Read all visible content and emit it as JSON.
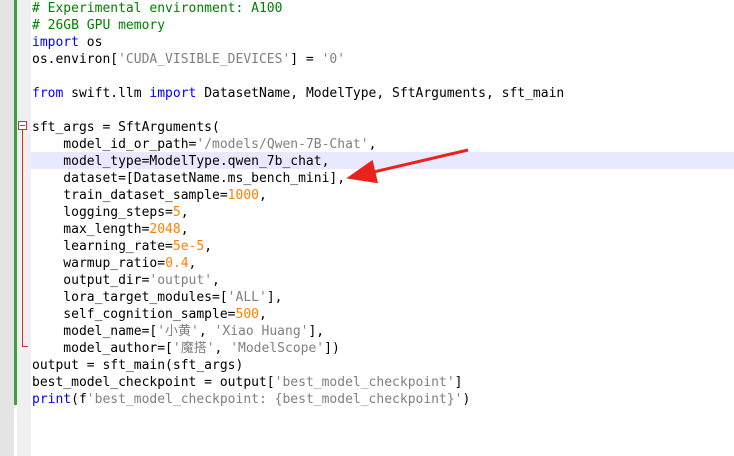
{
  "editor": {
    "lines": [
      [
        {
          "c": "cm",
          "t": "# Experimental environment: A100"
        }
      ],
      [
        {
          "c": "cm",
          "t": "# 26GB GPU memory"
        }
      ],
      [
        {
          "c": "kw",
          "t": "import"
        },
        {
          "c": "",
          "t": " os"
        }
      ],
      [
        {
          "c": "",
          "t": "os.environ["
        },
        {
          "c": "st",
          "t": "'CUDA_VISIBLE_DEVICES'"
        },
        {
          "c": "",
          "t": "] = "
        },
        {
          "c": "st",
          "t": "'0'"
        }
      ],
      [],
      [
        {
          "c": "kw",
          "t": "from"
        },
        {
          "c": "",
          "t": " swift.llm "
        },
        {
          "c": "kw",
          "t": "import"
        },
        {
          "c": "",
          "t": " DatasetName, ModelType, SftArguments, sft_main"
        }
      ],
      [],
      [
        {
          "c": "",
          "t": "sft_args = SftArguments("
        }
      ],
      [
        {
          "c": "",
          "t": "    model_id_or_path="
        },
        {
          "c": "st",
          "t": "'/models/Qwen-7B-Chat'"
        },
        {
          "c": "",
          "t": ","
        }
      ],
      [
        {
          "c": "",
          "t": "    model_type=ModelType.qwen_7b_chat,"
        }
      ],
      [
        {
          "c": "",
          "t": "    dataset=[DatasetName.ms_bench_mini],"
        }
      ],
      [
        {
          "c": "",
          "t": "    train_dataset_sample="
        },
        {
          "c": "nm",
          "t": "1000"
        },
        {
          "c": "",
          "t": ","
        }
      ],
      [
        {
          "c": "",
          "t": "    logging_steps="
        },
        {
          "c": "nm",
          "t": "5"
        },
        {
          "c": "",
          "t": ","
        }
      ],
      [
        {
          "c": "",
          "t": "    max_length="
        },
        {
          "c": "nm",
          "t": "2048"
        },
        {
          "c": "",
          "t": ","
        }
      ],
      [
        {
          "c": "",
          "t": "    learning_rate="
        },
        {
          "c": "nm",
          "t": "5e-5"
        },
        {
          "c": "",
          "t": ","
        }
      ],
      [
        {
          "c": "",
          "t": "    warmup_ratio="
        },
        {
          "c": "nm",
          "t": "0.4"
        },
        {
          "c": "",
          "t": ","
        }
      ],
      [
        {
          "c": "",
          "t": "    output_dir="
        },
        {
          "c": "st",
          "t": "'output'"
        },
        {
          "c": "",
          "t": ","
        }
      ],
      [
        {
          "c": "",
          "t": "    lora_target_modules=["
        },
        {
          "c": "st",
          "t": "'ALL'"
        },
        {
          "c": "",
          "t": "],"
        }
      ],
      [
        {
          "c": "",
          "t": "    self_cognition_sample="
        },
        {
          "c": "nm",
          "t": "500"
        },
        {
          "c": "",
          "t": ","
        }
      ],
      [
        {
          "c": "",
          "t": "    model_name=["
        },
        {
          "c": "st",
          "t": "'小黄'"
        },
        {
          "c": "",
          "t": ", "
        },
        {
          "c": "st",
          "t": "'Xiao Huang'"
        },
        {
          "c": "",
          "t": "],"
        }
      ],
      [
        {
          "c": "",
          "t": "    model_author=["
        },
        {
          "c": "st",
          "t": "'魔搭'"
        },
        {
          "c": "",
          "t": ", "
        },
        {
          "c": "st",
          "t": "'ModelScope'"
        },
        {
          "c": "",
          "t": "])"
        }
      ],
      [
        {
          "c": "",
          "t": "output = sft_main(sft_args)"
        }
      ],
      [
        {
          "c": "",
          "t": "best_model_checkpoint = output["
        },
        {
          "c": "st",
          "t": "'best_model_checkpoint'"
        },
        {
          "c": "",
          "t": "]"
        }
      ],
      [
        {
          "c": "kw",
          "t": "print"
        },
        {
          "c": "",
          "t": "(f"
        },
        {
          "c": "st",
          "t": "'best_model_checkpoint: {best_model_checkpoint}'"
        },
        {
          "c": "",
          "t": ")"
        }
      ]
    ],
    "highlighted_line": 10,
    "annotation": {
      "type": "arrow",
      "color": "#e8231a",
      "points_to_line": 11
    }
  }
}
